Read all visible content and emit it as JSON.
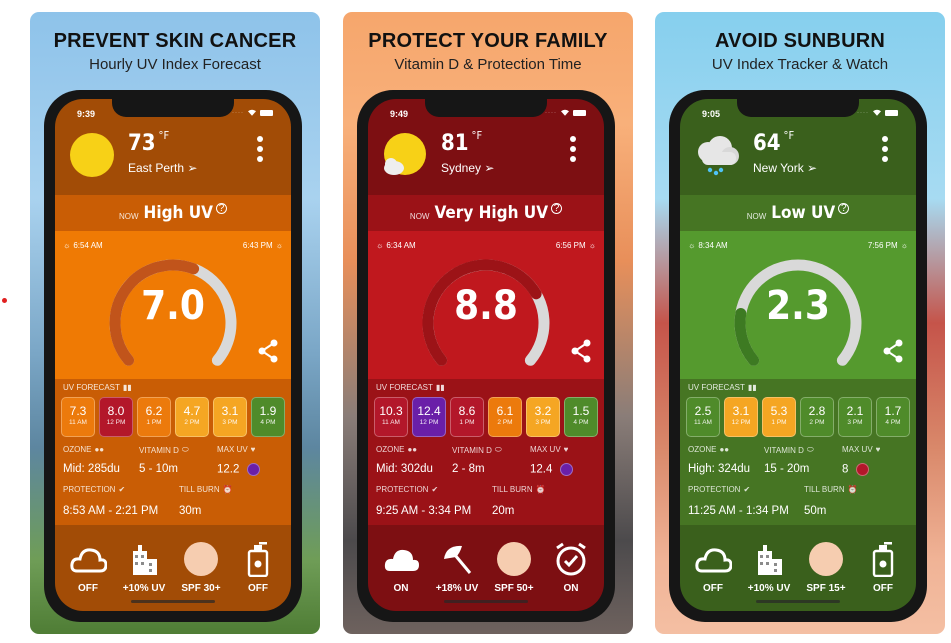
{
  "side_marker": "red-dot",
  "cards": [
    {
      "headline": "PREVENT SKIN CANCER",
      "subline": "Hourly UV Index Forecast",
      "theme": {
        "top": "#a24c06",
        "level": "#c95d05",
        "gauge_bg": "#ef7a04",
        "lower": "#c95d05",
        "bottom": "#a24c06",
        "arc_fill": "#c1541b",
        "arc_track": "#d9d9d9"
      },
      "status_time": "9:39",
      "weather_icon": "sun-icon",
      "temperature": "73",
      "temp_unit": "°F",
      "location": "East Perth",
      "now_label": "NOW",
      "uv_level": "High UV",
      "sunrise": "6:54 AM",
      "sunset": "6:43 PM",
      "uv_index": "7.0",
      "uv_fraction": 0.58,
      "forecast_title": "UV FORECAST",
      "forecast": [
        {
          "value": "7.3",
          "time": "11 AM",
          "color": "#ec7a0c"
        },
        {
          "value": "8.0",
          "time": "12 PM",
          "color": "#b3172a"
        },
        {
          "value": "6.2",
          "time": "1 PM",
          "color": "#ec7a0c"
        },
        {
          "value": "4.7",
          "time": "2 PM",
          "color": "#f5a623"
        },
        {
          "value": "3.1",
          "time": "3 PM",
          "color": "#f5a623"
        },
        {
          "value": "1.9",
          "time": "4 PM",
          "color": "#4f8b2a"
        }
      ],
      "ozone_label": "OZONE",
      "ozone_value": "Mid: 285du",
      "vitd_label": "VITAMIN D",
      "vitd_value": "5 - 10m",
      "maxuv_label": "MAX UV",
      "maxuv_value": "12.2",
      "maxuv_color": "#6a1fa8",
      "protection_label": "PROTECTION",
      "protection_value": "8:53 AM - 2:21 PM",
      "tillburn_label": "TILL BURN",
      "tillburn_value": "30m",
      "bottom": [
        {
          "icon": "cloud-outline-icon",
          "label": "OFF"
        },
        {
          "icon": "building-icon",
          "label": "+10% UV"
        },
        {
          "icon": "skin-tone-icon",
          "label": "SPF 30+"
        },
        {
          "icon": "sunscreen-icon",
          "label": "OFF"
        }
      ]
    },
    {
      "headline": "PROTECT YOUR FAMILY",
      "subline": "Vitamin D & Protection Time",
      "theme": {
        "top": "#7d0f12",
        "level": "#9b1217",
        "gauge_bg": "#c0181e",
        "lower": "#9b1217",
        "bottom": "#7d0f12",
        "arc_fill": "#9c1317",
        "arc_track": "#d9d9d9"
      },
      "status_time": "9:49",
      "weather_icon": "sun-cloud-icon",
      "temperature": "81",
      "temp_unit": "°F",
      "location": "Sydney",
      "now_label": "NOW",
      "uv_level": "Very High UV",
      "sunrise": "6:34 AM",
      "sunset": "6:56 PM",
      "uv_index": "8.8",
      "uv_fraction": 0.73,
      "forecast_title": "UV FORECAST",
      "forecast": [
        {
          "value": "10.3",
          "time": "11 AM",
          "color": "#b3172a"
        },
        {
          "value": "12.4",
          "time": "12 PM",
          "color": "#6a1fa8"
        },
        {
          "value": "8.6",
          "time": "1 PM",
          "color": "#b3172a"
        },
        {
          "value": "6.1",
          "time": "2 PM",
          "color": "#ec7a0c"
        },
        {
          "value": "3.2",
          "time": "3 PM",
          "color": "#f5a623"
        },
        {
          "value": "1.5",
          "time": "4 PM",
          "color": "#4f8b2a"
        }
      ],
      "ozone_label": "OZONE",
      "ozone_value": "Mid: 302du",
      "vitd_label": "VITAMIN D",
      "vitd_value": "2 - 8m",
      "maxuv_label": "MAX UV",
      "maxuv_value": "12.4",
      "maxuv_color": "#6a1fa8",
      "protection_label": "PROTECTION",
      "protection_value": "9:25 AM - 3:34 PM",
      "tillburn_label": "TILL BURN",
      "tillburn_value": "20m",
      "bottom": [
        {
          "icon": "cloud-filled-icon",
          "label": "ON"
        },
        {
          "icon": "umbrella-icon",
          "label": "+18% UV"
        },
        {
          "icon": "skin-tone-icon",
          "label": "SPF 50+"
        },
        {
          "icon": "alarm-clock-icon",
          "label": "ON"
        }
      ]
    },
    {
      "headline": "AVOID SUNBURN",
      "subline": "UV Index Tracker & Watch",
      "theme": {
        "top": "#3a601c",
        "level": "#467523",
        "gauge_bg": "#559a2e",
        "lower": "#467523",
        "bottom": "#3a601c",
        "arc_fill": "#3d7a22",
        "arc_track": "#d9d9d9"
      },
      "status_time": "9:05",
      "weather_icon": "rain-cloud-icon",
      "temperature": "64",
      "temp_unit": "°F",
      "location": "New York",
      "now_label": "NOW",
      "uv_level": "Low UV",
      "sunrise": "8:34 AM",
      "sunset": "7:56 PM",
      "uv_index": "2.3",
      "uv_fraction": 0.19,
      "forecast_title": "UV FORECAST",
      "forecast": [
        {
          "value": "2.5",
          "time": "11 AM",
          "color": "#4f8b2a"
        },
        {
          "value": "3.1",
          "time": "12 PM",
          "color": "#f5a623"
        },
        {
          "value": "5.3",
          "time": "1 PM",
          "color": "#f5a623"
        },
        {
          "value": "2.8",
          "time": "2 PM",
          "color": "#4f8b2a"
        },
        {
          "value": "2.1",
          "time": "3 PM",
          "color": "#4f8b2a"
        },
        {
          "value": "1.7",
          "time": "4 PM",
          "color": "#4f8b2a"
        }
      ],
      "ozone_label": "OZONE",
      "ozone_value": "High: 324du",
      "vitd_label": "VITAMIN D",
      "vitd_value": "15 - 20m",
      "maxuv_label": "MAX UV",
      "maxuv_value": "8",
      "maxuv_color": "#b3172a",
      "protection_label": "PROTECTION",
      "protection_value": "11:25 AM - 1:34 PM",
      "tillburn_label": "TILL BURN",
      "tillburn_value": "50m",
      "bottom": [
        {
          "icon": "cloud-outline-icon",
          "label": "OFF"
        },
        {
          "icon": "building-icon",
          "label": "+10% UV"
        },
        {
          "icon": "skin-tone-icon",
          "label": "SPF 15+"
        },
        {
          "icon": "sunscreen-icon",
          "label": "OFF"
        }
      ]
    }
  ]
}
